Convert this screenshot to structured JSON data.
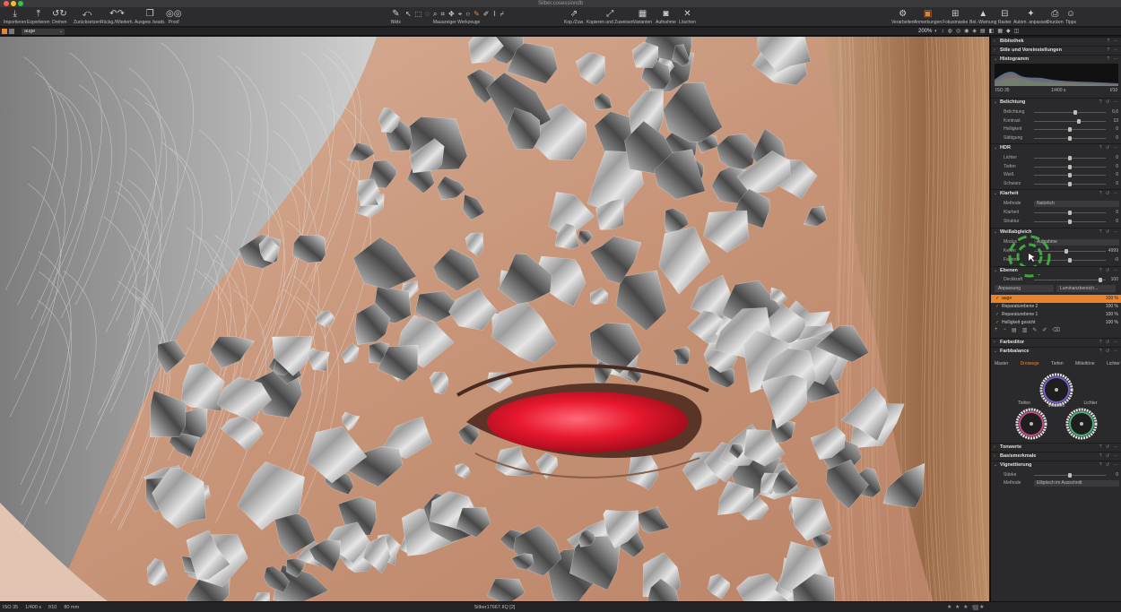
{
  "window": {
    "title": "Silber.cosessiondb"
  },
  "toolbar": {
    "left": [
      {
        "label": "Importieren",
        "icon": "import-icon",
        "glyph": "⤓"
      },
      {
        "label": "Exportieren",
        "icon": "export-icon",
        "glyph": "⤒"
      },
      {
        "label": "Drehen",
        "icon": "rotate-icon",
        "glyph": "↺↻"
      },
      {
        "label": "Zurücksetzen",
        "icon": "reset-icon",
        "glyph": "⤺"
      },
      {
        "label": "Rückg./Wiederh.",
        "icon": "undo-redo-icon",
        "glyph": "↶↷"
      },
      {
        "label": "Ausgew. bearb.",
        "icon": "edit-selected-icon",
        "glyph": "❐"
      },
      {
        "label": "Proof",
        "icon": "proof-icon",
        "glyph": "◎◎"
      }
    ],
    "center": [
      {
        "label": "Bildx",
        "icon": "brush-icon",
        "glyph": "✎"
      }
    ],
    "cursor_tools_label": "Mauszeiger Werkzeuge",
    "cursor_tools": [
      "↖",
      "⬚",
      "◌",
      "⌕",
      "⌗",
      "✥",
      "⌖",
      "○",
      "✎",
      "✐",
      "⌇",
      "⌿"
    ],
    "right_center": [
      {
        "label": "Kop./Zuw.",
        "icon": "copy-apply-icon",
        "glyph": "⇗"
      },
      {
        "label": "Kopieren und Zuweisen",
        "icon": "copy-paste-icon",
        "glyph": "⤢"
      },
      {
        "label": "Varianten",
        "icon": "variants-icon",
        "glyph": "▦"
      },
      {
        "label": "Aufnahme",
        "icon": "camera-icon",
        "glyph": "◙"
      },
      {
        "label": "Löschen",
        "icon": "delete-icon",
        "glyph": "✕"
      }
    ],
    "right": [
      {
        "label": "Verarbeiten",
        "icon": "process-gear-icon",
        "glyph": "⚙"
      },
      {
        "label": "Anmerkungen",
        "icon": "annotations-icon",
        "glyph": "▣",
        "active": true
      },
      {
        "label": "Fokusmaske",
        "icon": "focus-mask-icon",
        "glyph": "⊞"
      },
      {
        "label": "Bel.-Warnung",
        "icon": "exposure-warning-icon",
        "glyph": "▲"
      },
      {
        "label": "Raster",
        "icon": "grid-icon",
        "glyph": "⊟"
      },
      {
        "label": "Autom. anpassen",
        "icon": "auto-adjust-icon",
        "glyph": "✦"
      },
      {
        "label": "Drucken",
        "icon": "print-icon",
        "glyph": "⎙"
      },
      {
        "label": "Tipps",
        "icon": "tips-icon",
        "glyph": "☺"
      }
    ]
  },
  "subbar": {
    "variant_select": "auge",
    "zoom": "200%",
    "icons": [
      "◐",
      "↕",
      "◍",
      "◎",
      "◉",
      "◈",
      "▤",
      "◧",
      "▦",
      "◆",
      "◫"
    ]
  },
  "footer": {
    "iso": "ISO 35",
    "shutter": "1/400 s",
    "aperture": "f/10",
    "focal": "80 mm",
    "filename": "Silber17667.IIQ [2]",
    "stars": "★ ★ ★ ★ ★"
  },
  "panel": {
    "header_actions": "? ⋯",
    "section_actions": "? ↺ ⋯",
    "sections": {
      "bibliothek": "Bibliothek",
      "stile": "Stile und Voreinstellungen",
      "histogramm": "Histogramm",
      "belichtung": "Belichtung",
      "hdr": "HDR",
      "klarheit": "Klarheit",
      "weissabgleich": "Weißabgleich",
      "ebenen": "Ebenen",
      "farbeditor": "Farbeditor",
      "farbbalance": "Farbbalance",
      "tonwerte": "Tonwerte",
      "basismerkmale": "Basismerkmale",
      "vignettierung": "Vignettierung"
    },
    "histogram": {
      "iso": "ISO 35",
      "shutter": "1/400 s",
      "aperture": "f/10"
    },
    "belichtung": [
      {
        "label": "Belichtung",
        "value": "0,6",
        "pos": 0.58
      },
      {
        "label": "Kontrast",
        "value": "13",
        "pos": 0.62
      },
      {
        "label": "Helligkeit",
        "value": "0",
        "pos": 0.5
      },
      {
        "label": "Sättigung",
        "value": "0",
        "pos": 0.5
      }
    ],
    "hdr": [
      {
        "label": "Lichter",
        "value": "0",
        "pos": 0.5
      },
      {
        "label": "Tiefen",
        "value": "0",
        "pos": 0.5
      },
      {
        "label": "Weiß",
        "value": "0",
        "pos": 0.5
      },
      {
        "label": "Schwarz",
        "value": "0",
        "pos": 0.5
      }
    ],
    "klarheit": {
      "method_label": "Methode",
      "method_value": "Natürlich",
      "sliders": [
        {
          "label": "Klarheit",
          "value": "0",
          "pos": 0.5
        },
        {
          "label": "Struktur",
          "value": "0",
          "pos": 0.5
        }
      ]
    },
    "weissabgleich": {
      "mode_label": "Modus",
      "mode_value": "Aufnahme",
      "sliders": [
        {
          "label": "Kelvin",
          "value": "4999",
          "pos": 0.45
        },
        {
          "label": "Farbton",
          "value": "-0",
          "pos": 0.5
        }
      ]
    },
    "ebenen": {
      "opacity_label": "Deckkraft",
      "opacity_value": "100",
      "buttons": [
        "Anpassung",
        "Luminanzbereich..."
      ],
      "layers": [
        {
          "name": "auge",
          "pct": "100 %",
          "selected": true
        },
        {
          "name": "Reparaturebene 2",
          "pct": "100 %",
          "selected": false
        },
        {
          "name": "Reparaturebene 1",
          "pct": "100 %",
          "selected": false
        },
        {
          "name": "Helligkeit gesicht",
          "pct": "100 %",
          "selected": false
        }
      ],
      "tools": [
        "+",
        "−",
        "▤",
        "▥",
        "✎",
        "✐",
        "⌫"
      ]
    },
    "farbbalance": {
      "tabs": [
        "Master",
        "Dreiwege",
        "Tiefen",
        "Mitteltöne",
        "Lichter"
      ],
      "active_tab": "Dreiwege",
      "wheels": {
        "mid": "Mitteltön",
        "shadow": "Tiefen",
        "light": "Lichter"
      }
    },
    "vignettierung": {
      "strength_label": "Stärke",
      "strength_value": "0",
      "strength_pos": 0.5,
      "method_label": "Methode",
      "method_value": "Elliptisch im Ausschnitt"
    }
  },
  "colors": {
    "accent": "#e8852c",
    "panel": "#2a2a2c",
    "toolbar": "#2c2c2e"
  }
}
